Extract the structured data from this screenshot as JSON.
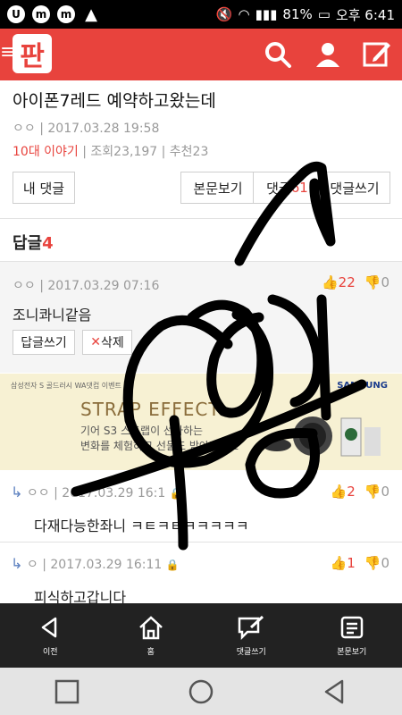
{
  "status_bar": {
    "battery": "81%",
    "time": "오후 6:41"
  },
  "post": {
    "title": "아이폰7레드 예약하고왔는데",
    "author": "ㅇㅇ",
    "date": "2017.03.28 19:58",
    "category": "10대 이야기",
    "views": "조회23,197",
    "recommends": "추천23"
  },
  "buttons": {
    "my_comments": "내 댓글",
    "view_post": "본문보기",
    "comments_label": "댓글",
    "comments_count": "61",
    "write_comment": "댓글쓰기"
  },
  "replies": {
    "label": "답글",
    "count": "4"
  },
  "comments": [
    {
      "author": "ㅇㅇ",
      "date": "2017.03.29 07:16",
      "text": "조니콰니같음",
      "up": "22",
      "down": "0",
      "reply_button": "답글쓰기",
      "delete_button": "삭제"
    },
    {
      "author": "ㅇㅇ",
      "date": "2017.03.29 16:1",
      "text": "다재다능한좌니 ㅋㅌㅋㅌㅋㅋㅋㅋㅋ",
      "up": "2",
      "down": "0"
    },
    {
      "author": "ㅇ",
      "date": "2017.03.29 16:11",
      "text": "피식하고갑니다",
      "up": "1",
      "down": "0"
    }
  ],
  "ad": {
    "brand": "삼성전자 S 골드러시 WA댓컵 이벤트",
    "samsung": "SAMSUNG",
    "headline": "STRAP EFFECT",
    "line1": "기어 S3 스트랩이 선사하는",
    "line2": "변화를 체험하고 선물도 받아가세요"
  },
  "bottom_nav": [
    {
      "label": "이전"
    },
    {
      "label": "홈"
    },
    {
      "label": "댓글쓰기"
    },
    {
      "label": "본문보기"
    }
  ]
}
